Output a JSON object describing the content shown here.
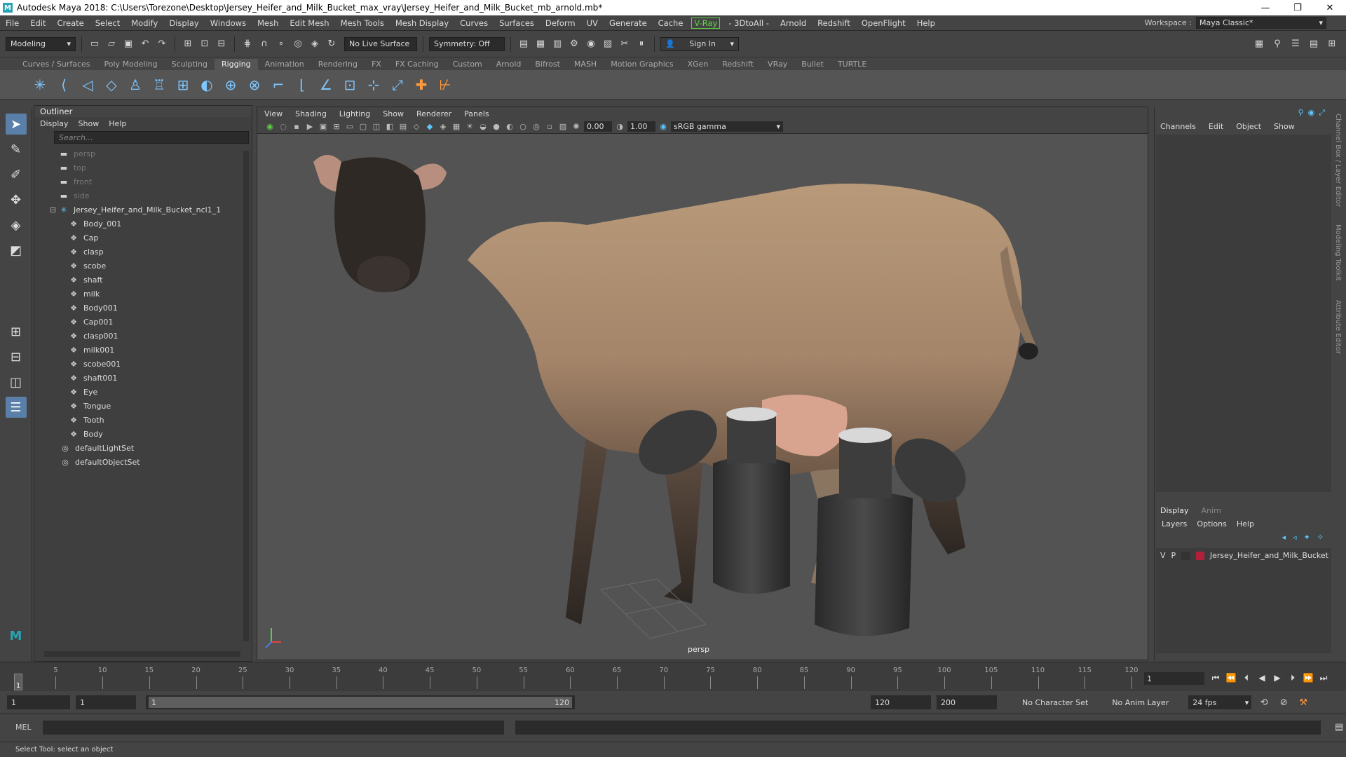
{
  "window": {
    "title": "Autodesk Maya 2018: C:\\Users\\Torezone\\Desktop\\Jersey_Heifer_and_Milk_Bucket_max_vray\\Jersey_Heifer_and_Milk_Bucket_mb_arnold.mb*",
    "logo": "M",
    "minimize": "—",
    "restore": "❐",
    "close": "✕"
  },
  "menubar": {
    "items": [
      "File",
      "Edit",
      "Create",
      "Select",
      "Modify",
      "Display",
      "Windows",
      "Mesh",
      "Edit Mesh",
      "Mesh Tools",
      "Mesh Display",
      "Curves",
      "Surfaces",
      "Deform",
      "UV",
      "Generate",
      "Cache"
    ],
    "vray": "V-Ray",
    "items2": [
      "- 3DtoAll -",
      "Arnold",
      "Redshift",
      "OpenFlight",
      "Help"
    ],
    "workspace_label": "Workspace :",
    "workspace_value": "Maya Classic*"
  },
  "statusline": {
    "mode": "Modeling",
    "live_surface": "No Live Surface",
    "symmetry": "Symmetry: Off",
    "sign_in": "Sign In"
  },
  "shelf": {
    "tabs": [
      "Curves / Surfaces",
      "Poly Modeling",
      "Sculpting",
      "Rigging",
      "Animation",
      "Rendering",
      "FX",
      "FX Caching",
      "Custom",
      "Arnold",
      "Bifrost",
      "MASH",
      "Motion Graphics",
      "XGen",
      "Redshift",
      "VRay",
      "Bullet",
      "TURTLE"
    ],
    "active_tab": "Rigging"
  },
  "outliner": {
    "title": "Outliner",
    "menu": [
      "Display",
      "Show",
      "Help"
    ],
    "search_placeholder": "Search...",
    "cameras": [
      "persp",
      "top",
      "front",
      "side"
    ],
    "root": "Jersey_Heifer_and_Milk_Bucket_ncl1_1",
    "children": [
      "Body_001",
      "Cap",
      "clasp",
      "scobe",
      "shaft",
      "milk",
      "Body001",
      "Cap001",
      "clasp001",
      "milk001",
      "scobe001",
      "shaft001",
      "Eye",
      "Tongue",
      "Tooth",
      "Body"
    ],
    "sets": [
      "defaultLightSet",
      "defaultObjectSet"
    ]
  },
  "viewport": {
    "menu": [
      "View",
      "Shading",
      "Lighting",
      "Show",
      "Renderer",
      "Panels"
    ],
    "exposure": "0.00",
    "gamma": "1.00",
    "color_space": "sRGB gamma",
    "camera_label": "persp"
  },
  "channel_box": {
    "menu": [
      "Channels",
      "Edit",
      "Object",
      "Show"
    ]
  },
  "layer_editor": {
    "tabs": [
      "Display",
      "Anim"
    ],
    "menu": [
      "Layers",
      "Options",
      "Help"
    ],
    "layer_v": "V",
    "layer_p": "P",
    "layer_name": "Jersey_Heifer_and_Milk_Bucket",
    "layer_color": "#b1203a"
  },
  "side_tabs": [
    "Channel Box / Layer Editor",
    "Modeling Toolkit",
    "Attribute Editor"
  ],
  "timeline": {
    "ticks": [
      5,
      10,
      15,
      20,
      25,
      30,
      35,
      40,
      45,
      50,
      55,
      60,
      65,
      70,
      75,
      80,
      85,
      90,
      95,
      100,
      105,
      110,
      115,
      120
    ],
    "min": 1,
    "max": 120,
    "current_frame": "1",
    "current_frame_field": "1"
  },
  "range": {
    "start": "1",
    "playback_start": "1",
    "slider_start": "1",
    "slider_end": "120",
    "playback_end": "120",
    "end": "200",
    "character_set": "No Character Set",
    "anim_layer": "No Anim Layer",
    "fps": "24 fps"
  },
  "command_line": {
    "label": "MEL"
  },
  "help_line": {
    "text": "Select Tool: select an object"
  }
}
